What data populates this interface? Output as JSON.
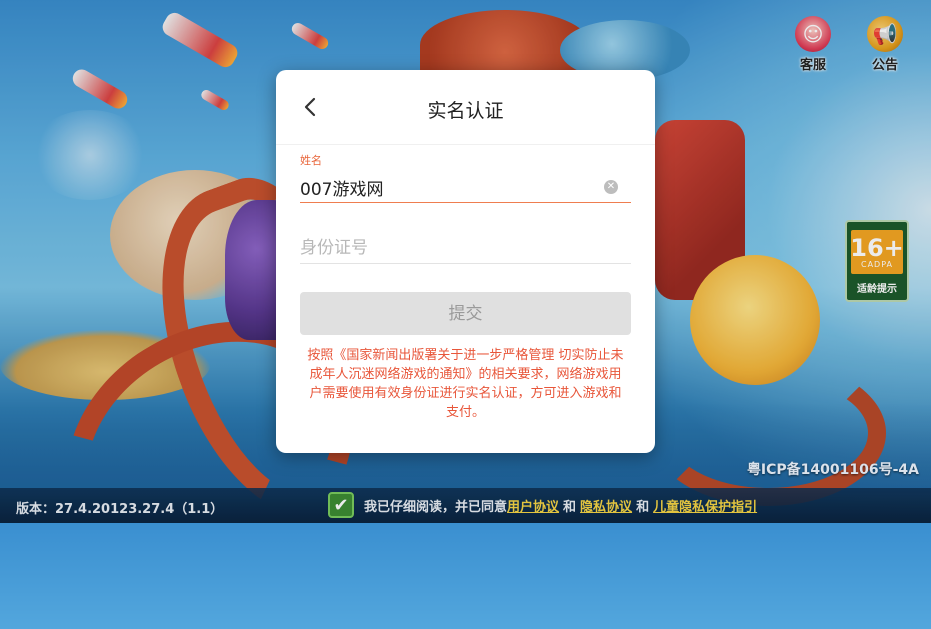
{
  "top_icons": {
    "service_label": "客服",
    "notice_label": "公告"
  },
  "age_rating": {
    "number": "16+",
    "org": "CADPA",
    "tip": "适龄提示"
  },
  "icp": "粤ICP备14001106号-4A",
  "bottom": {
    "version": "版本：27.4.20123.27.4（1.1）",
    "agree_text": "我已仔细阅读，并已同意",
    "link_user": "用户协议",
    "and_1": "和",
    "link_privacy": "隐私协议",
    "and_2": "和",
    "link_child": "儿童隐私保护指引"
  },
  "dialog": {
    "title": "实名认证",
    "name_label": "姓名",
    "name_value": "007游戏网",
    "id_placeholder": "身份证号",
    "submit_label": "提交",
    "notice": "按照《国家新闻出版署关于进一步严格管理 切实防止未成年人沉迷网络游戏的通知》的相关要求，网络游戏用户需要使用有效身份证进行实名认证，方可进入游戏和支付。"
  },
  "colors": {
    "accent": "#e8563a",
    "button_disabled": "#e0e0e0",
    "link": "#f6d545"
  }
}
